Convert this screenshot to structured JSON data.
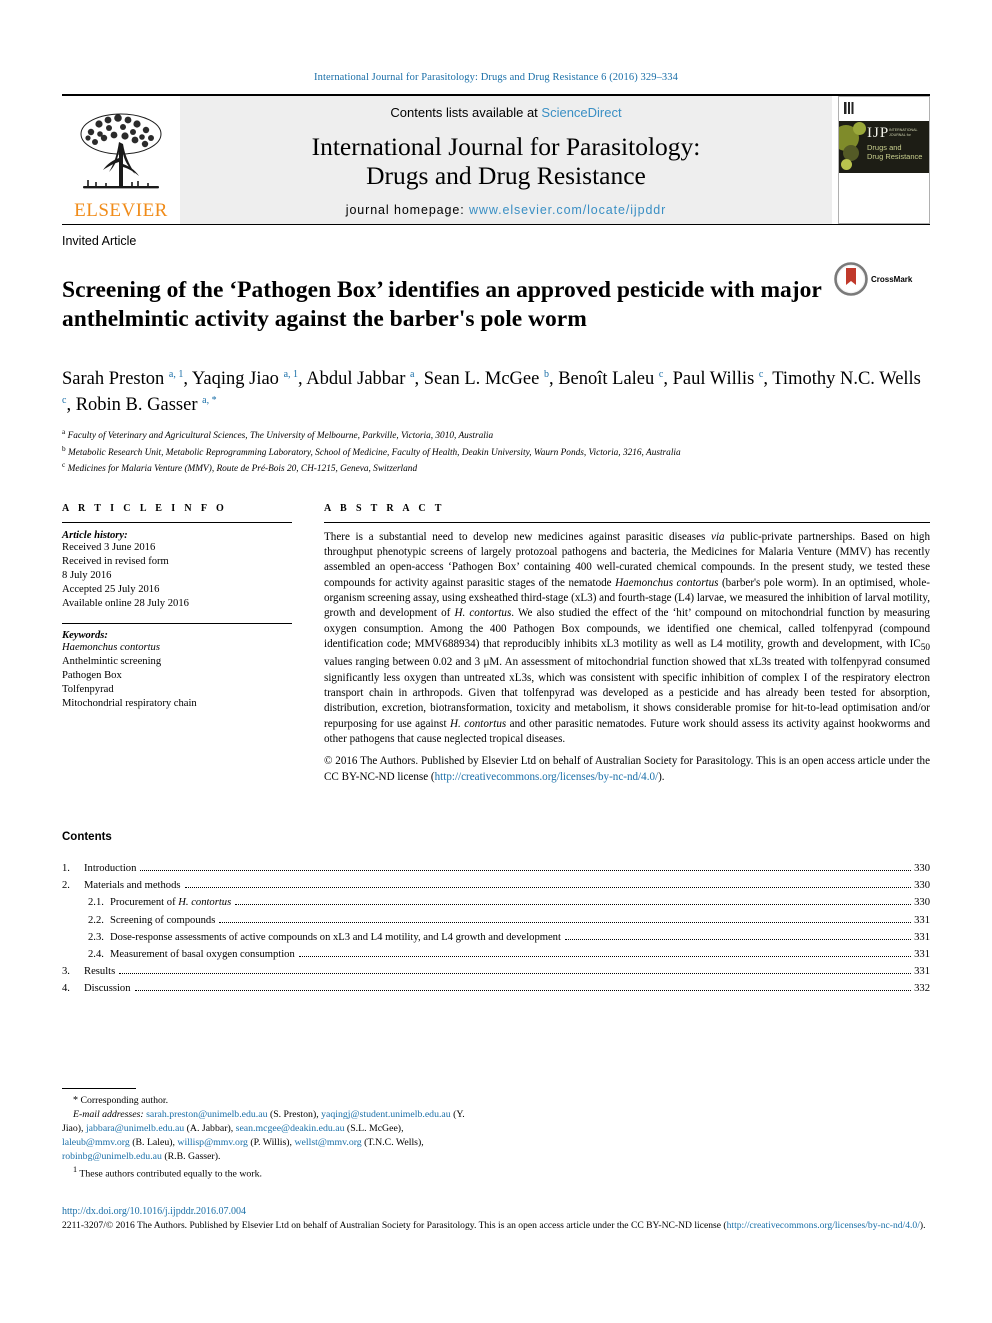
{
  "running_head": "International Journal for Parasitology: Drugs and Drug Resistance 6 (2016) 329–334",
  "masthead": {
    "publisher": "ELSEVIER",
    "contents_prefix": "Contents lists available at ",
    "contents_link": "ScienceDirect",
    "journal_title_line1": "International Journal for Parasitology:",
    "journal_title_line2": "Drugs and Drug Resistance",
    "homepage_label": "journal homepage: ",
    "homepage_url": "www.elsevier.com/locate/ijpddr",
    "cover": {
      "acronym": "IJP",
      "acronym_sub": "INTERNATIONAL\nJOURNAL for",
      "subtitle_line1": "Drugs and",
      "subtitle_line2": "Drug Resistance"
    }
  },
  "article": {
    "type": "Invited Article",
    "title": "Screening of the ‘Pathogen Box’ identifies an approved pesticide with major anthelmintic activity against the barber's pole worm",
    "crossmark_label": "CrossMark",
    "authors_html": "Sarah Preston <sup>a, 1</sup>, Yaqing Jiao <sup>a, 1</sup>, Abdul Jabbar <sup>a</sup>, Sean L. McGee <sup>b</sup>, Benoît Laleu <sup>c</sup>, Paul Willis <sup>c</sup>, Timothy N.C. Wells <sup>c</sup>, Robin B. Gasser <sup>a, *</sup>",
    "affiliations": [
      {
        "marker": "a",
        "text": "Faculty of Veterinary and Agricultural Sciences, The University of Melbourne, Parkville, Victoria, 3010, Australia"
      },
      {
        "marker": "b",
        "text": "Metabolic Research Unit, Metabolic Reprogramming Laboratory, School of Medicine, Faculty of Health, Deakin University, Waurn Ponds, Victoria, 3216, Australia"
      },
      {
        "marker": "c",
        "text": "Medicines for Malaria Venture (MMV), Route de Pré-Bois 20, CH-1215, Geneva, Switzerland"
      }
    ]
  },
  "article_info": {
    "heading": "A R T I C L E   I N F O",
    "history_label": "Article history:",
    "history": [
      "Received 3 June 2016",
      "Received in revised form",
      "8 July 2016",
      "Accepted 25 July 2016",
      "Available online 28 July 2016"
    ],
    "keywords_label": "Keywords:",
    "keywords": [
      "Haemonchus contortus",
      "Anthelmintic screening",
      "Pathogen Box",
      "Tolfenpyrad",
      "Mitochondrial respiratory chain"
    ],
    "keywords_italic_index": 0
  },
  "abstract": {
    "heading": "A B S T R A C T",
    "body_html": "There is a substantial need to develop new medicines against parasitic diseases <i>via</i> public-private partnerships. Based on high throughput phenotypic screens of largely protozoal pathogens and bacteria, the Medicines for Malaria Venture (MMV) has recently assembled an open-access ‘Pathogen Box’ containing 400 well-curated chemical compounds. In the present study, we tested these compounds for activity against parasitic stages of the nematode <i>Haemonchus contortus</i> (barber's pole worm). In an optimised, whole-organism screening assay, using exsheathed third-stage (xL3) and fourth-stage (L4) larvae, we measured the inhibition of larval motility, growth and development of <i>H. contortus</i>. We also studied the effect of the ‘hit’ compound on mitochondrial function by measuring oxygen consumption. Among the 400 Pathogen Box compounds, we identified one chemical, called tolfenpyrad (compound identification code; MMV688934) that reproducibly inhibits xL3 motility as well as L4 motility, growth and development, with IC<sub>50</sub> values ranging between 0.02 and 3 μM. An assessment of mitochondrial function showed that xL3s treated with tolfenpyrad consumed significantly less oxygen than untreated xL3s, which was consistent with specific inhibition of complex I of the respiratory electron transport chain in arthropods. Given that tolfenpyrad was developed as a pesticide and has already been tested for absorption, distribution, excretion, biotransformation, toxicity and metabolism, it shows considerable promise for hit-to-lead optimisation and/or repurposing for use against <i>H. contortus</i> and other parasitic nematodes. Future work should assess its activity against hookworms and other pathogens that cause neglected tropical diseases.",
    "copyright_html": "© 2016 The Authors. Published by Elsevier Ltd on behalf of Australian Society for Parasitology. This is an open access article under the CC BY-NC-ND license (<span class=\"lic-link\">http://creativecommons.org/licenses/by-nc-nd/4.0/</span>)."
  },
  "contents": {
    "title": "Contents",
    "entries": [
      {
        "num": "1.",
        "label_html": "Introduction",
        "page": "330",
        "level": 1
      },
      {
        "num": "2.",
        "label_html": "Materials and methods",
        "page": "330",
        "level": 1
      },
      {
        "num": "2.1.",
        "label_html": "Procurement of <i>H. contortus</i>",
        "page": "330",
        "level": 2
      },
      {
        "num": "2.2.",
        "label_html": "Screening of compounds",
        "page": "331",
        "level": 2
      },
      {
        "num": "2.3.",
        "label_html": "Dose-response assessments of active compounds on xL3 and L4 motility, and L4 growth and development",
        "page": "331",
        "level": 2
      },
      {
        "num": "2.4.",
        "label_html": "Measurement of basal oxygen consumption",
        "page": "331",
        "level": 2
      },
      {
        "num": "3.",
        "label_html": "Results",
        "page": "331",
        "level": 1
      },
      {
        "num": "4.",
        "label_html": "Discussion",
        "page": "332",
        "level": 1
      }
    ]
  },
  "footnotes": {
    "corresponding_marker": "*",
    "corresponding_text": "Corresponding author.",
    "email_label": "E-mail addresses:",
    "emails_html": "<span class=\"fn-link\">sarah.preston@unimelb.edu.au</span> (S. Preston), <span class=\"fn-link\">yaqingj@student.unimelb.edu.au</span> (Y. Jiao), <span class=\"fn-link\">jabbara@unimelb.edu.au</span> (A. Jabbar), <span class=\"fn-link\">sean.mcgee@deakin.edu.au</span> (S.L. McGee), <span class=\"fn-link\">laleub@mmv.org</span> (B. Laleu), <span class=\"fn-link\">willisp@mmv.org</span> (P. Willis), <span class=\"fn-link\">wellst@mmv.org</span> (T.N.C. Wells), <span class=\"fn-link\">robinbg@unimelb.edu.au</span> (R.B. Gasser).",
    "equal_marker": "1",
    "equal_text": "These authors contributed equally to the work."
  },
  "bottom": {
    "doi": "http://dx.doi.org/10.1016/j.ijpddr.2016.07.004",
    "issn_html": "2211-3207/© 2016 The Authors. Published by Elsevier Ltd on behalf of Australian Society for Parasitology. This is an open access article under the CC BY-NC-ND license (<span class=\"fn-link\">http://creativecommons.org/licenses/by-nc-nd/4.0/</span>)."
  },
  "colors": {
    "link_blue": "#1a6fa8",
    "sciencedirect_blue": "#3a8fc4",
    "elsevier_orange": "#f08c1a",
    "masthead_grey": "#eeeeee",
    "crossmark_red": "#c0392b"
  }
}
